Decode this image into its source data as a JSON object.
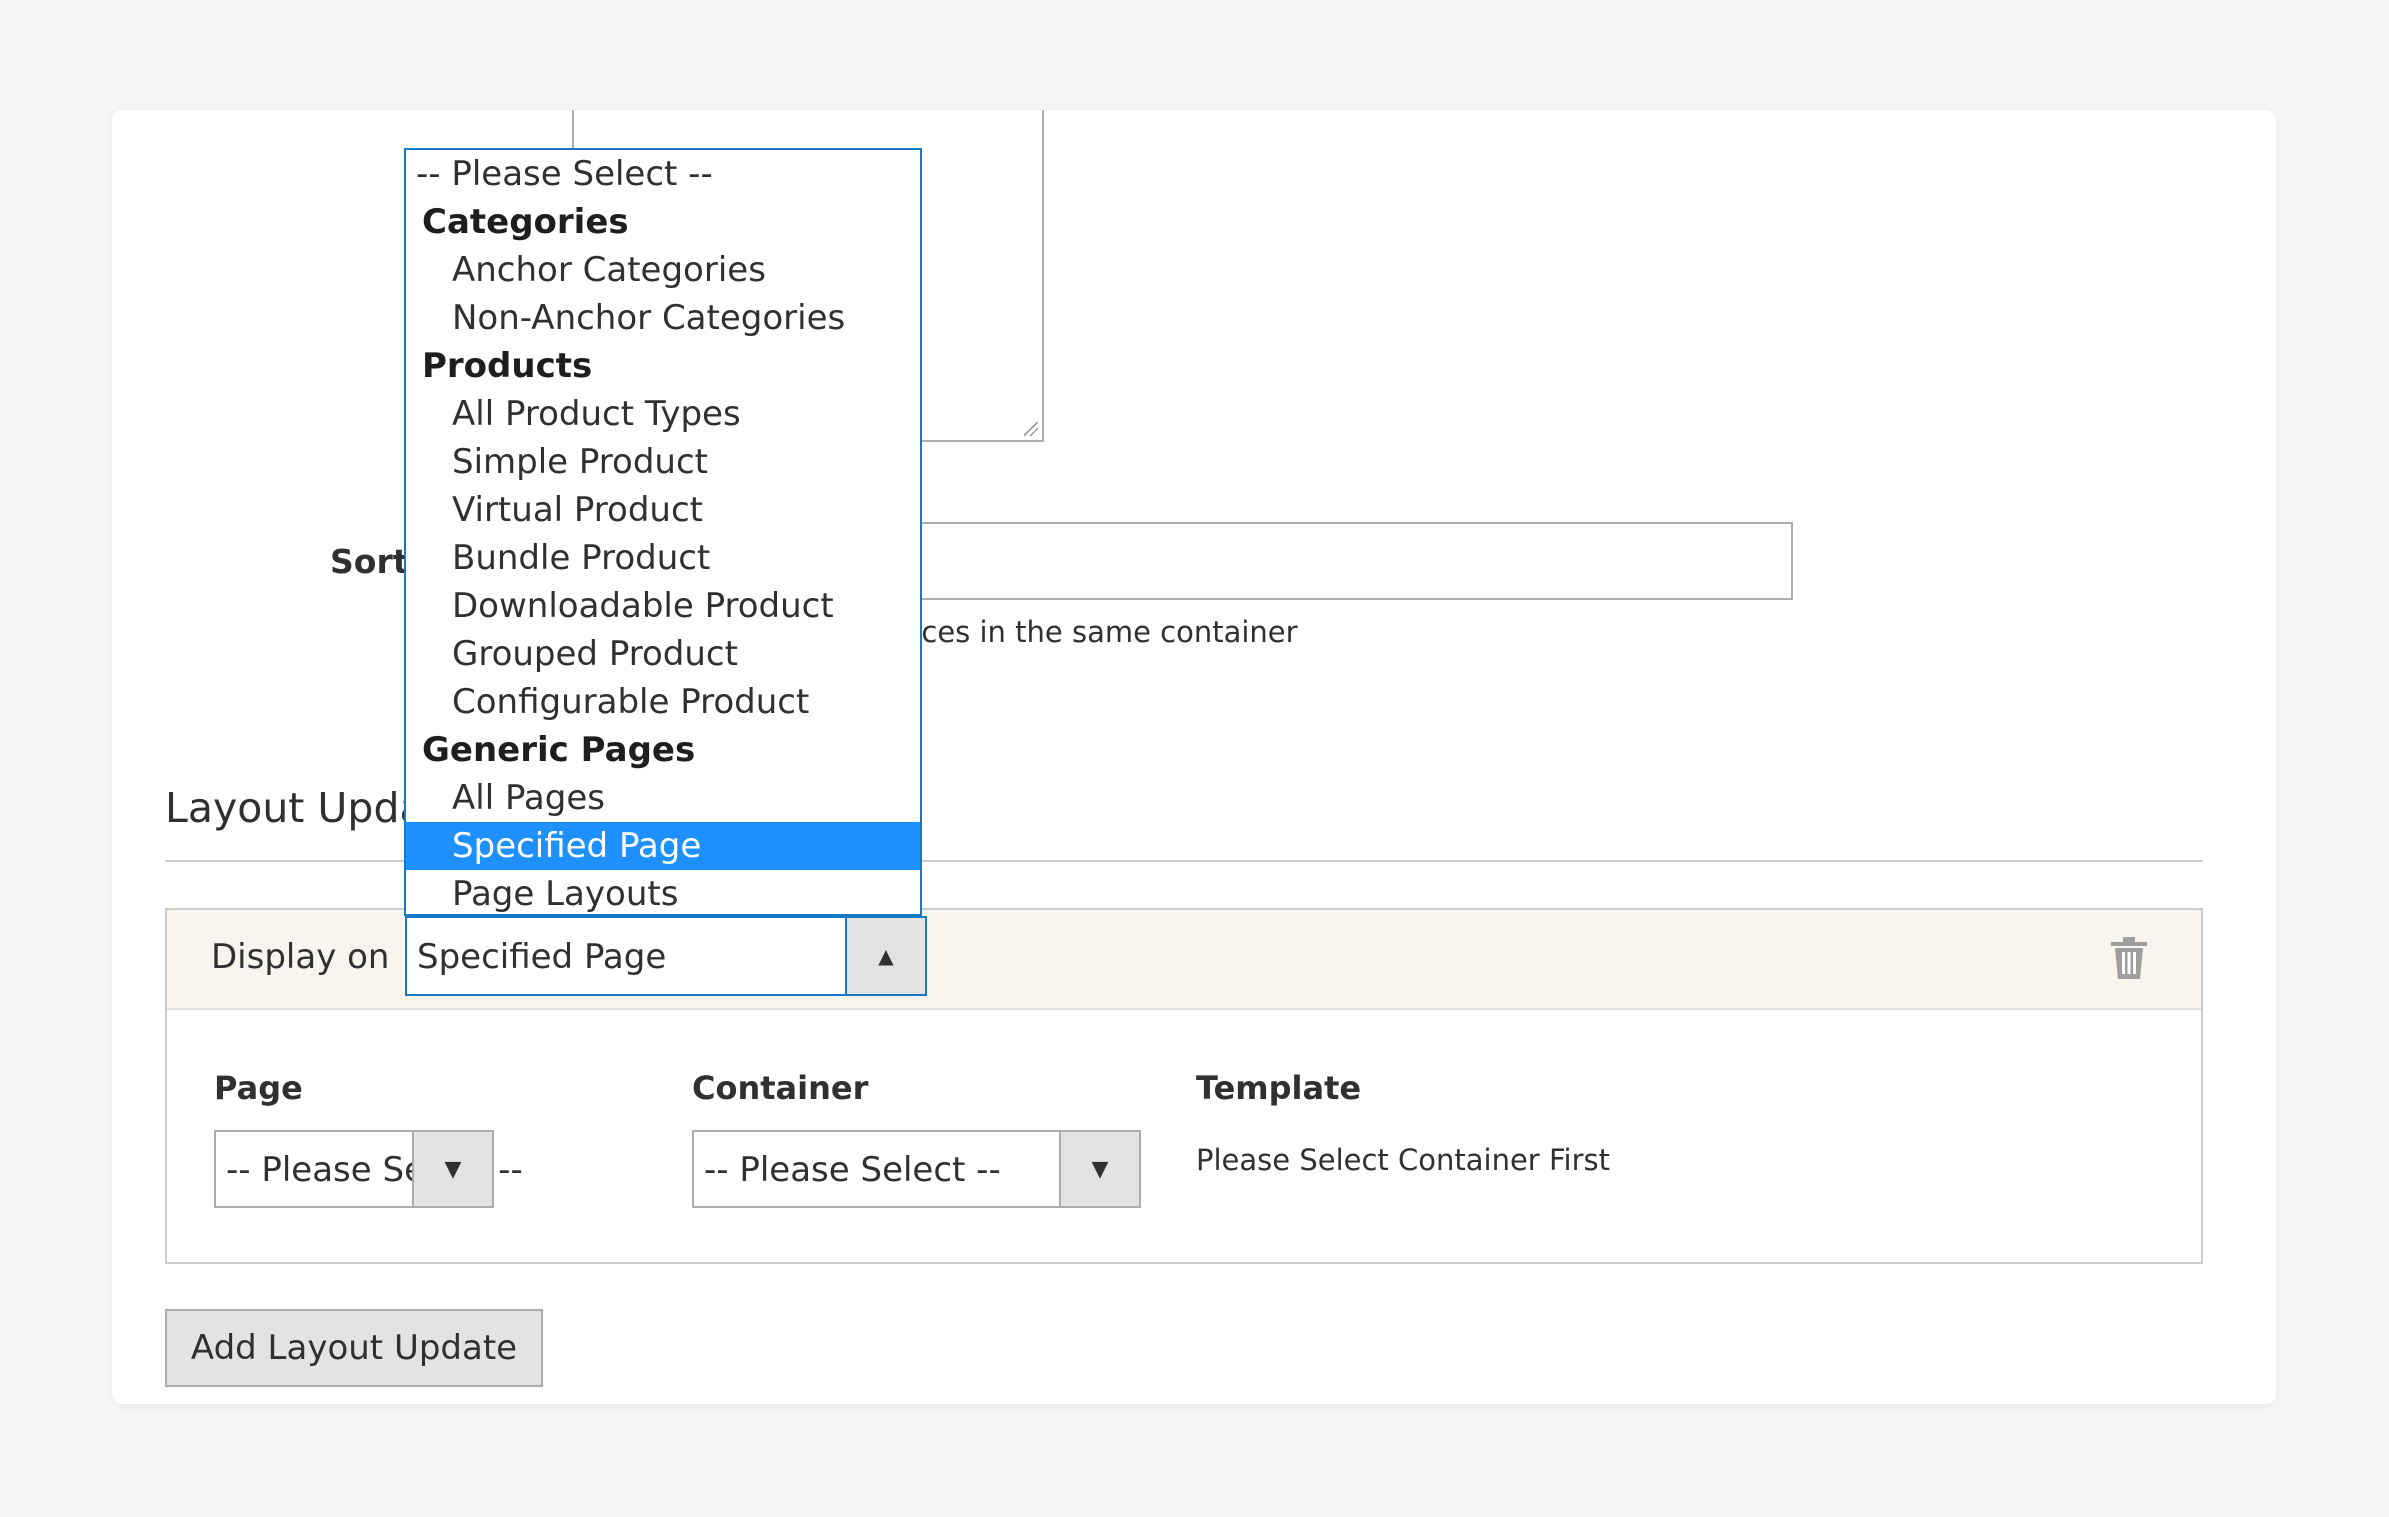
{
  "sort": {
    "label": "Sort",
    "note": "nces in the same container"
  },
  "layout_updates": {
    "title": "Layout Upda",
    "display_on": {
      "label": "Display on",
      "value": "Specified Page"
    },
    "page": {
      "label": "Page",
      "value": "-- Please Select --"
    },
    "container": {
      "label": "Container",
      "value": "-- Please Select --"
    },
    "template": {
      "label": "Template",
      "note": "Please Select Container First"
    },
    "add_button": "Add Layout Update"
  },
  "icons": {
    "trash": "trash-icon",
    "arrow_up": "▲",
    "arrow_down": "▼"
  },
  "dropdown": {
    "items": [
      {
        "type": "placeholder",
        "label": "-- Please Select --"
      },
      {
        "type": "group",
        "label": "Categories"
      },
      {
        "type": "option",
        "label": "Anchor Categories"
      },
      {
        "type": "option",
        "label": "Non-Anchor Categories"
      },
      {
        "type": "group",
        "label": "Products"
      },
      {
        "type": "option",
        "label": "All Product Types"
      },
      {
        "type": "option",
        "label": "Simple Product"
      },
      {
        "type": "option",
        "label": "Virtual Product"
      },
      {
        "type": "option",
        "label": "Bundle Product"
      },
      {
        "type": "option",
        "label": "Downloadable Product"
      },
      {
        "type": "option",
        "label": "Grouped Product"
      },
      {
        "type": "option",
        "label": "Configurable Product"
      },
      {
        "type": "group",
        "label": "Generic Pages"
      },
      {
        "type": "option",
        "label": "All Pages"
      },
      {
        "type": "option",
        "label": "Specified Page",
        "selected": true
      },
      {
        "type": "option",
        "label": "Page Layouts"
      }
    ]
  },
  "colors": {
    "accent": "#1979c3",
    "selected_option": "#1e90ff",
    "header_bg": "#f8f5ef"
  }
}
